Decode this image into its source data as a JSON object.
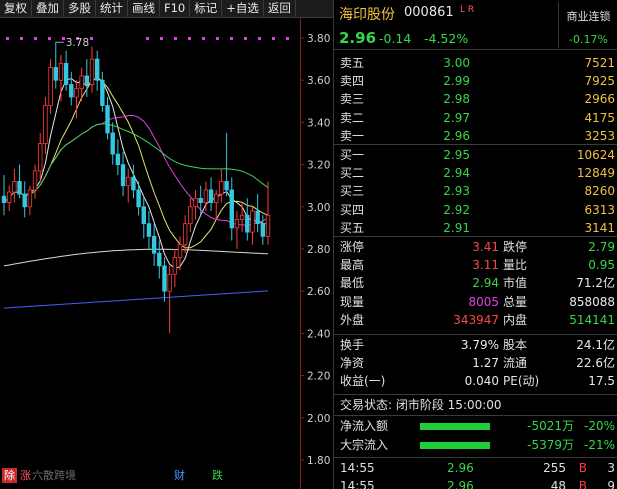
{
  "toolbar": {
    "items": [
      "复权",
      "叠加",
      "多股",
      "统计",
      "画线",
      "F10",
      "标记",
      "+自选",
      "返回"
    ]
  },
  "chart": {
    "peak_label": "3.78",
    "y_ticks": [
      "3.80",
      "3.60",
      "3.40",
      "3.20",
      "3.00",
      "2.80",
      "2.60",
      "2.40",
      "2.20",
      "2.00",
      "1.80"
    ],
    "candles": [
      [
        3.05,
        3.15,
        2.96,
        3.02
      ],
      [
        3.02,
        3.1,
        2.98,
        3.07
      ],
      [
        3.07,
        3.18,
        3.02,
        3.12
      ],
      [
        3.12,
        3.2,
        3.04,
        3.06
      ],
      [
        3.06,
        3.12,
        2.95,
        3.0
      ],
      [
        3.0,
        3.1,
        2.96,
        3.08
      ],
      [
        3.08,
        3.2,
        3.04,
        3.17
      ],
      [
        3.17,
        3.35,
        3.12,
        3.3
      ],
      [
        3.3,
        3.52,
        3.25,
        3.48
      ],
      [
        3.48,
        3.7,
        3.44,
        3.66
      ],
      [
        3.66,
        3.78,
        3.56,
        3.6
      ],
      [
        3.6,
        3.72,
        3.5,
        3.68
      ],
      [
        3.68,
        3.74,
        3.55,
        3.58
      ],
      [
        3.58,
        3.64,
        3.48,
        3.52
      ],
      [
        3.52,
        3.6,
        3.42,
        3.56
      ],
      [
        3.56,
        3.66,
        3.5,
        3.62
      ],
      [
        3.62,
        3.7,
        3.52,
        3.58
      ],
      [
        3.58,
        3.76,
        3.54,
        3.7
      ],
      [
        3.7,
        3.74,
        3.55,
        3.6
      ],
      [
        3.6,
        3.64,
        3.45,
        3.48
      ],
      [
        3.48,
        3.52,
        3.32,
        3.35
      ],
      [
        3.35,
        3.4,
        3.2,
        3.25
      ],
      [
        3.25,
        3.32,
        3.15,
        3.2
      ],
      [
        3.2,
        3.26,
        3.05,
        3.1
      ],
      [
        3.1,
        3.18,
        3.02,
        3.14
      ],
      [
        3.14,
        3.2,
        3.04,
        3.08
      ],
      [
        3.08,
        3.12,
        2.96,
        3.0
      ],
      [
        3.0,
        3.05,
        2.85,
        2.92
      ],
      [
        2.92,
        2.98,
        2.8,
        2.86
      ],
      [
        2.86,
        2.92,
        2.72,
        2.78
      ],
      [
        2.78,
        2.84,
        2.66,
        2.72
      ],
      [
        2.72,
        2.76,
        2.55,
        2.6
      ],
      [
        2.6,
        2.72,
        2.4,
        2.68
      ],
      [
        2.68,
        2.8,
        2.62,
        2.76
      ],
      [
        2.76,
        2.86,
        2.7,
        2.82
      ],
      [
        2.82,
        2.96,
        2.78,
        2.92
      ],
      [
        2.92,
        3.04,
        2.88,
        3.0
      ],
      [
        3.0,
        3.08,
        2.94,
        3.04
      ],
      [
        3.04,
        3.1,
        2.96,
        3.02
      ],
      [
        3.02,
        3.12,
        2.98,
        3.08
      ],
      [
        3.08,
        3.14,
        2.98,
        3.02
      ],
      [
        3.02,
        3.08,
        2.94,
        3.06
      ],
      [
        3.06,
        3.18,
        3.02,
        3.12
      ],
      [
        3.12,
        3.35,
        3.05,
        3.08
      ],
      [
        3.08,
        3.14,
        2.84,
        2.9
      ],
      [
        2.9,
        2.98,
        2.8,
        2.94
      ],
      [
        2.94,
        3.02,
        2.88,
        2.96
      ],
      [
        2.96,
        3.04,
        2.84,
        2.88
      ],
      [
        2.88,
        3.0,
        2.82,
        2.98
      ],
      [
        2.98,
        3.06,
        2.88,
        2.92
      ],
      [
        2.92,
        2.96,
        2.82,
        2.86
      ],
      [
        2.86,
        3.12,
        2.82,
        2.96
      ]
    ],
    "ma_colors": [
      "#e8e8e8",
      "#e8e070",
      "#e040e0",
      "#3fd45a",
      "#4a5cff"
    ]
  },
  "bottom_strip": {
    "ex": "除",
    "za": "涨",
    "news": "六散跨境",
    "cai": "财",
    "die": "跌"
  },
  "quote": {
    "name": "海印股份",
    "code": "000861",
    "lr": "L R",
    "sector_name": "商业连锁",
    "sector_change": "-0.17%",
    "price": "2.96",
    "change": "-0.14",
    "change_pct": "-4.52%",
    "asks": [
      {
        "label": "卖五",
        "price": "3.00",
        "vol": "7521"
      },
      {
        "label": "卖四",
        "price": "2.99",
        "vol": "7925"
      },
      {
        "label": "卖三",
        "price": "2.98",
        "vol": "2966"
      },
      {
        "label": "卖二",
        "price": "2.97",
        "vol": "4175"
      },
      {
        "label": "卖一",
        "price": "2.96",
        "vol": "3253"
      }
    ],
    "bids": [
      {
        "label": "买一",
        "price": "2.95",
        "vol": "10624"
      },
      {
        "label": "买二",
        "price": "2.94",
        "vol": "12849"
      },
      {
        "label": "买三",
        "price": "2.93",
        "vol": "8260"
      },
      {
        "label": "买四",
        "price": "2.92",
        "vol": "6313"
      },
      {
        "label": "买五",
        "price": "2.91",
        "vol": "3141"
      }
    ],
    "stats1": [
      {
        "l1": "涨停",
        "v1": "3.41",
        "l2": "跌停",
        "v2": "2.79"
      },
      {
        "l1": "最高",
        "v1": "3.11",
        "l2": "量比",
        "v2": "0.95"
      },
      {
        "l1": "最低",
        "v1": "2.94",
        "l2": "市值",
        "v2": "71.2亿"
      },
      {
        "l1": "现量",
        "v1": "8005",
        "l2": "总量",
        "v2": "858088"
      },
      {
        "l1": "外盘",
        "v1": "343947",
        "l2": "内盘",
        "v2": "514141"
      }
    ],
    "stats2": [
      {
        "l1": "换手",
        "v1": "3.79%",
        "l2": "股本",
        "v2": "24.1亿"
      },
      {
        "l1": "净资",
        "v1": "1.27",
        "l2": "流通",
        "v2": "22.6亿"
      },
      {
        "l1": "收益(一)",
        "v1": "0.040",
        "l2": "PE(动)",
        "v2": "17.5"
      }
    ],
    "trade_status": "交易状态: 闭市阶段 15:00:00",
    "flows": [
      {
        "label": "净流入额",
        "value": "-5021万",
        "pct": "-20%"
      },
      {
        "label": "大宗流入",
        "value": "-5379万",
        "pct": "-21%"
      }
    ],
    "ticks": [
      {
        "time": "14:55",
        "price": "2.96",
        "vol": "255",
        "bs": "B",
        "n": "3"
      },
      {
        "time": "14:55",
        "price": "2.96",
        "vol": "48",
        "bs": "B",
        "n": "9"
      }
    ]
  }
}
